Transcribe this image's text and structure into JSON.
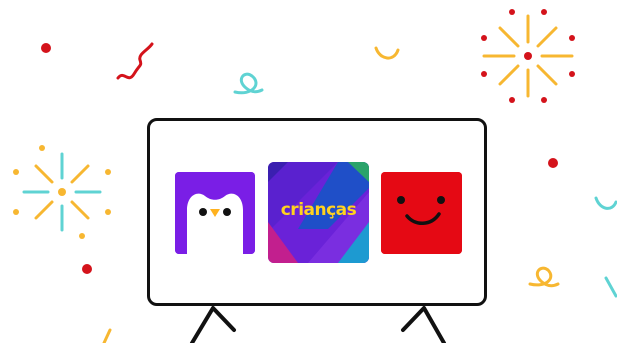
{
  "profiles": [
    {
      "name": "penguin-profile",
      "label": ""
    },
    {
      "name": "kids-profile",
      "label": "crianças"
    },
    {
      "name": "smile-profile",
      "label": ""
    }
  ],
  "colors": {
    "penguin_tile": "#7a1ee6",
    "kids_label": "#ffd21f",
    "smile_tile": "#e50914",
    "confetti_red": "#d4131b",
    "confetti_yellow": "#f7b731",
    "confetti_teal": "#5fd3d3",
    "tv_outline": "#111111"
  },
  "icons": [
    "penguin-icon",
    "smile-icon",
    "firework-icon",
    "confetti-squiggle-icon"
  ]
}
